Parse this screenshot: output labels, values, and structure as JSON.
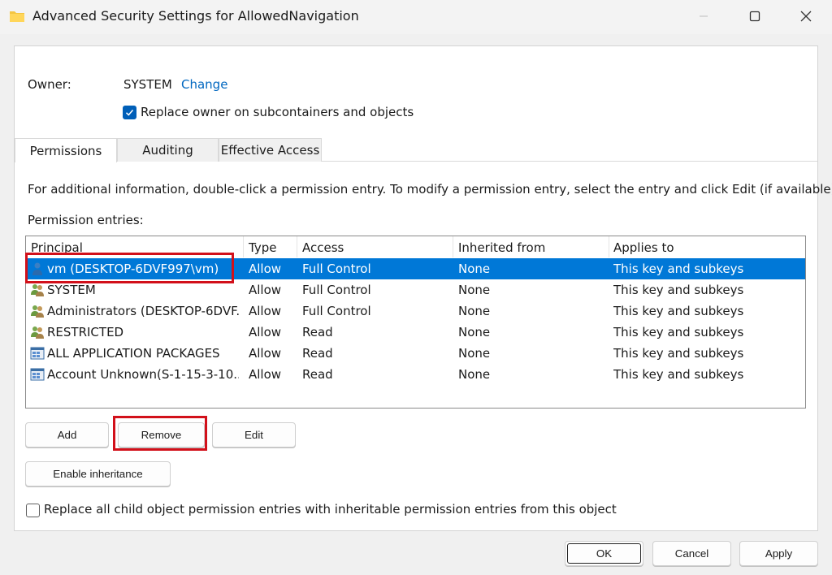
{
  "window": {
    "title": "Advanced Security Settings for AllowedNavigation"
  },
  "owner": {
    "label": "Owner:",
    "value": "SYSTEM",
    "change_link": "Change",
    "replace_checkbox_label": "Replace owner on subcontainers and objects",
    "replace_checked": true
  },
  "tabs": [
    {
      "label": "Permissions",
      "active": true
    },
    {
      "label": "Auditing",
      "active": false
    },
    {
      "label": "Effective Access",
      "active": false
    }
  ],
  "info_text": "For additional information, double-click a permission entry. To modify a permission entry, select the entry and click Edit (if available).",
  "entries_label": "Permission entries:",
  "table": {
    "columns": [
      "Principal",
      "Type",
      "Access",
      "Inherited from",
      "Applies to"
    ],
    "rows": [
      {
        "principal": "vm (DESKTOP-6DVF997\\vm)",
        "type": "Allow",
        "access": "Full Control",
        "inherited": "None",
        "applies": "This key and subkeys",
        "icon": "user-icon",
        "selected": true
      },
      {
        "principal": "SYSTEM",
        "type": "Allow",
        "access": "Full Control",
        "inherited": "None",
        "applies": "This key and subkeys",
        "icon": "group-icon",
        "selected": false
      },
      {
        "principal": "Administrators (DESKTOP-6DVF...",
        "type": "Allow",
        "access": "Full Control",
        "inherited": "None",
        "applies": "This key and subkeys",
        "icon": "group-icon",
        "selected": false
      },
      {
        "principal": "RESTRICTED",
        "type": "Allow",
        "access": "Read",
        "inherited": "None",
        "applies": "This key and subkeys",
        "icon": "group-icon",
        "selected": false
      },
      {
        "principal": "ALL APPLICATION PACKAGES",
        "type": "Allow",
        "access": "Read",
        "inherited": "None",
        "applies": "This key and subkeys",
        "icon": "app-package-icon",
        "selected": false
      },
      {
        "principal": "Account Unknown(S-1-15-3-10...",
        "type": "Allow",
        "access": "Read",
        "inherited": "None",
        "applies": "This key and subkeys",
        "icon": "app-package-icon",
        "selected": false
      }
    ]
  },
  "buttons": {
    "add": "Add",
    "remove": "Remove",
    "edit": "Edit",
    "enable_inheritance": "Enable inheritance",
    "ok": "OK",
    "cancel": "Cancel",
    "apply": "Apply"
  },
  "replace_child": {
    "label": "Replace all child object permission entries with inheritable permission entries from this object",
    "checked": false
  },
  "colors": {
    "selection": "#0078d7",
    "link": "#0067c0",
    "checkbox": "#005fb8",
    "annotation": "#d2101a"
  }
}
